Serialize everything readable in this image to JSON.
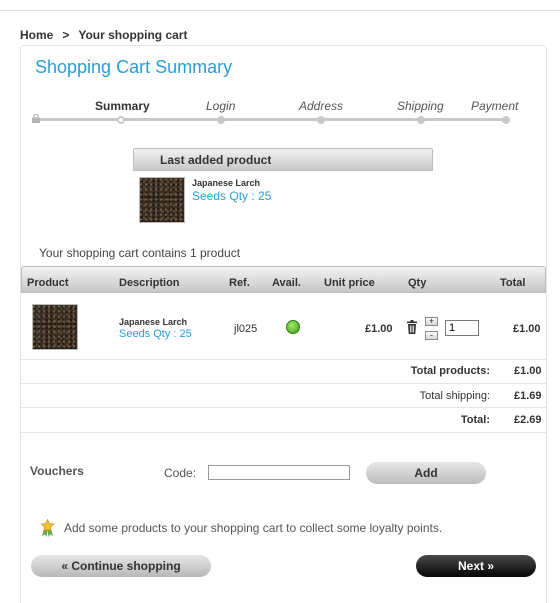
{
  "breadcrumb": {
    "home": "Home",
    "separator": ">",
    "current": "Your shopping cart"
  },
  "title": "Shopping Cart Summary",
  "steps": [
    {
      "label": "Summary",
      "state": "current"
    },
    {
      "label": "Login",
      "state": "todo"
    },
    {
      "label": "Address",
      "state": "todo"
    },
    {
      "label": "Shipping",
      "state": "todo"
    },
    {
      "label": "Payment",
      "state": "todo"
    }
  ],
  "last_added": {
    "heading": "Last added product",
    "name": "Japanese Larch",
    "attributes": "Seeds Qty : 25"
  },
  "cart_count_text": "Your shopping cart contains 1 product",
  "table": {
    "headers": {
      "product": "Product",
      "description": "Description",
      "ref": "Ref.",
      "avail": "Avail.",
      "unit_price": "Unit price",
      "qty": "Qty",
      "total": "Total"
    },
    "rows": [
      {
        "name": "Japanese Larch",
        "attributes": "Seeds Qty : 25",
        "ref": "jl025",
        "availability": "in-stock",
        "unit_price": "£1.00",
        "qty": "1",
        "qty_up": "+",
        "qty_down": "-",
        "total": "£1.00"
      }
    ]
  },
  "totals": {
    "products_label": "Total products:",
    "products_value": "£1.00",
    "shipping_label": "Total shipping:",
    "shipping_value": "£1.69",
    "total_label": "Total:",
    "total_value": "£2.69"
  },
  "vouchers": {
    "label": "Vouchers",
    "code_label": "Code:",
    "code_value": "",
    "add_button": "Add"
  },
  "loyalty_text": "Add some products to your shopping cart to collect some loyalty points.",
  "buttons": {
    "continue": "« Continue shopping",
    "next": "Next »"
  },
  "colors": {
    "accent": "#2a9fd1",
    "in_stock": "#3e9a16",
    "next_button": "#050505"
  }
}
